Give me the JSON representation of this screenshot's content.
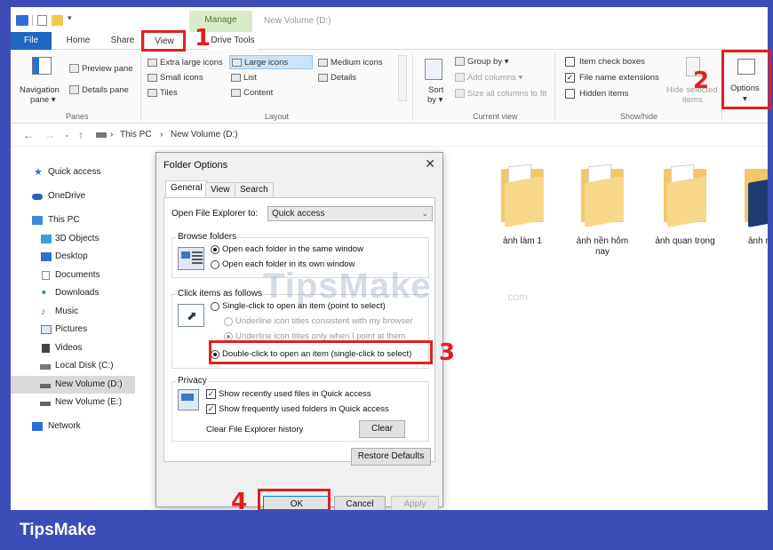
{
  "window": {
    "title": "New Volume (D:)",
    "context_tab": "Manage"
  },
  "tabs": {
    "file": "File",
    "home": "Home",
    "share": "Share",
    "view": "View",
    "drive_tools": "Drive Tools"
  },
  "ribbon": {
    "panes": {
      "label": "Panes",
      "navigation_pane": "Navigation",
      "navigation_pane2": "pane ▾",
      "preview_pane": "Preview pane",
      "details_pane": "Details pane"
    },
    "layout": {
      "label": "Layout",
      "items": [
        "Extra large icons",
        "Large icons",
        "Medium icons",
        "Small icons",
        "List",
        "Details",
        "Tiles",
        "Content"
      ]
    },
    "current_view": {
      "label": "Current view",
      "sort_by": "Sort",
      "sort_by2": "by ▾",
      "group_by": "Group by ▾",
      "add_columns": "Add columns ▾",
      "size_all": "Size all columns to fit"
    },
    "show_hide": {
      "label": "Show/hide",
      "item_check_boxes": "Item check boxes",
      "file_name_extensions": "File name extensions",
      "hidden_items": "Hidden items",
      "hide_selected": "Hide selected",
      "hide_selected2": "items"
    },
    "options": "Options",
    "options_caret": "▾"
  },
  "address": {
    "crumbs": [
      "This PC",
      "New Volume (D:)"
    ],
    "sep": "›"
  },
  "sidebar": {
    "items": [
      "Quick access",
      "OneDrive",
      "This PC",
      "3D Objects",
      "Desktop",
      "Documents",
      "Downloads",
      "Music",
      "Pictures",
      "Videos",
      "Local Disk (C:)",
      "New Volume (D:)",
      "New Volume (E:)",
      "Network"
    ]
  },
  "folders": [
    "ảnh làm 1",
    "ảnh nền hôm nay",
    "ảnh quan trọng",
    "ảnh r"
  ],
  "dialog": {
    "title": "Folder Options",
    "close": "✕",
    "tabs": [
      "General",
      "View",
      "Search"
    ],
    "open_explorer_label": "Open File Explorer to:",
    "open_explorer_value": "Quick access",
    "browse_folders": {
      "legend": "Browse folders",
      "same_window": "Open each folder in the same window",
      "own_window": "Open each folder in its own window"
    },
    "click_items": {
      "legend": "Click items as follows",
      "single_click": "Single-click to open an item (point to select)",
      "underline_consistent": "Underline icon titles consistent with my browser",
      "underline_point": "Underline icon titles only when I point at them",
      "double_click": "Double-click to open an item (single-click to select)"
    },
    "privacy": {
      "legend": "Privacy",
      "recent_files": "Show recently used files in Quick access",
      "frequent_folders": "Show frequently used folders in Quick access",
      "clear_history": "Clear File Explorer history",
      "clear_button": "Clear"
    },
    "restore_defaults": "Restore Defaults",
    "ok": "OK",
    "cancel": "Cancel",
    "apply": "Apply"
  },
  "annotations": [
    "1",
    "2",
    "3",
    "4"
  ],
  "watermark": "TipsMake",
  "watermark_suffix": ".com",
  "brand": "TipsMake",
  "colors": {
    "brand_band": "#3d4db8",
    "annotation_red": "#e02020",
    "file_tab": "#1f66c1",
    "manage_tab": "#d9ecc9"
  }
}
